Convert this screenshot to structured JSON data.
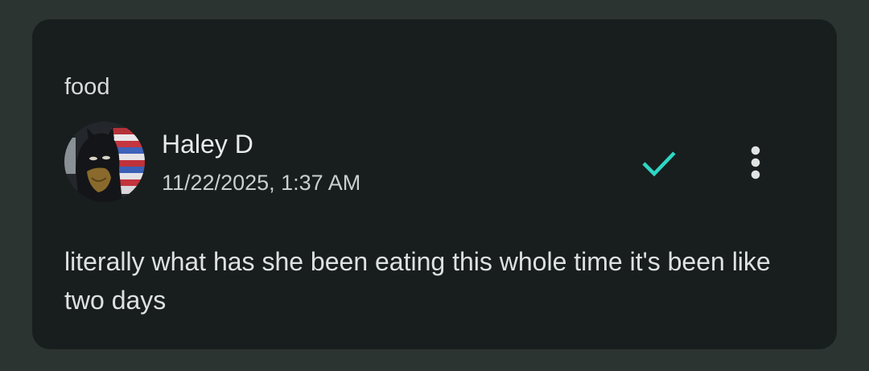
{
  "post": {
    "topic": "food",
    "author": "Haley D",
    "timestamp": "11/22/2025, 1:37 AM",
    "message": "literally what has she been eating this whole time it's been like two days"
  },
  "icons": {
    "status": "checkmark-icon",
    "menu": "more-vert-icon"
  },
  "colors": {
    "background": "#2c3431",
    "card": "#181e1d",
    "accent": "#2fd6c4",
    "text_primary": "#e8ecea"
  }
}
